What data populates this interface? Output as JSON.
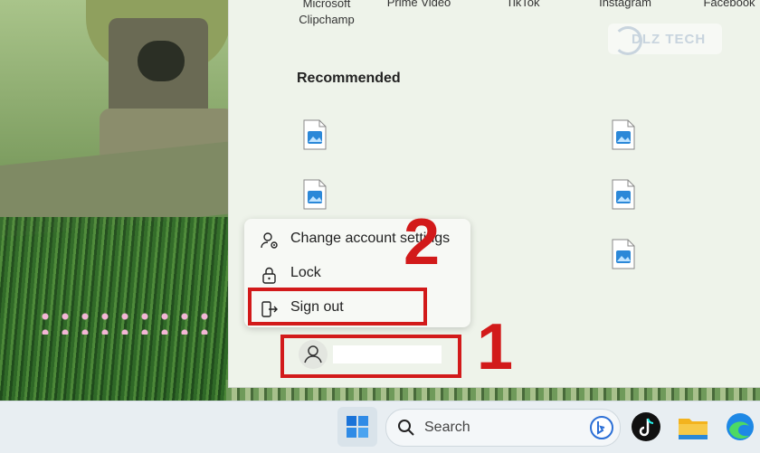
{
  "start_menu": {
    "pinned_apps": [
      {
        "label": "Microsoft\nClipchamp"
      },
      {
        "label": "Prime Video"
      },
      {
        "label": "TikTok"
      },
      {
        "label": "Instagram"
      },
      {
        "label": "Facebook"
      }
    ],
    "recommended_title": "Recommended",
    "watermark": "DLZ TECH"
  },
  "context_menu": {
    "items": [
      {
        "label": "Change account settings",
        "icon": "account-settings-icon"
      },
      {
        "label": "Lock",
        "icon": "lock-icon"
      },
      {
        "label": "Sign out",
        "icon": "sign-out-icon"
      }
    ]
  },
  "user": {
    "name": ""
  },
  "annotations": {
    "step1": "1",
    "step2": "2",
    "highlight_color": "#d21a1a"
  },
  "taskbar": {
    "search_placeholder": "Search"
  }
}
